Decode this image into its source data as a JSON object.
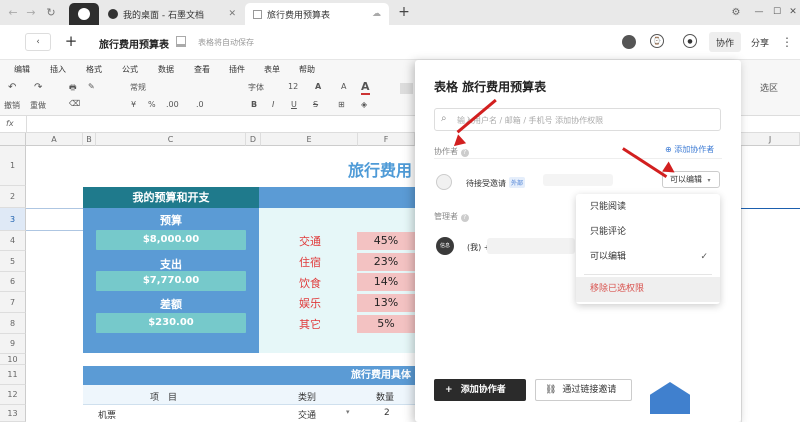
{
  "tabs": [
    {
      "label": "我的桌面 - 石墨文档"
    },
    {
      "label": "旅行费用预算表"
    }
  ],
  "header": {
    "title": "旅行费用预算表",
    "autosave": "表格将自动保存",
    "collab": "协作",
    "share": "分享"
  },
  "menu": [
    "编辑",
    "插入",
    "格式",
    "公式",
    "数据",
    "查看",
    "插件",
    "表单",
    "帮助"
  ],
  "toolbar": {
    "undo": "撤销",
    "redo": "重做",
    "format": "常规",
    "currency": "¥",
    "percent": "%",
    "decimals": ".00",
    ".0": ".0",
    "font": "字体",
    "size": "12",
    "filter_area": "选区"
  },
  "formula": {
    "fx": "fx"
  },
  "columns": [
    "A",
    "B",
    "C",
    "D",
    "E",
    "F",
    "J"
  ],
  "rows": [
    "1",
    "2",
    "3",
    "4",
    "5",
    "6",
    "7",
    "8",
    "9",
    "10",
    "11",
    "12",
    "13"
  ],
  "sheet": {
    "title": "旅行费用",
    "section_title": "我的预算和开支",
    "budget_label": "预算",
    "budget": "$8,000.00",
    "spend_label": "支出",
    "spend": "$7,770.00",
    "diff_label": "差额",
    "diff": "$230.00",
    "categories": [
      "交通",
      "住宿",
      "饮食",
      "娱乐",
      "其它"
    ],
    "pcts": [
      "45%",
      "23%",
      "14%",
      "13%",
      "5%"
    ],
    "detail_title": "旅行费用具体",
    "detail_headers": [
      "项　目",
      "类别",
      "数量"
    ],
    "row13": [
      "机票",
      "交通",
      "2"
    ]
  },
  "panel": {
    "title": "表格 旅行费用预算表",
    "search_placeholder": "输入用户名 / 邮箱 / 手机号 添加协作权限",
    "collaborators": "协作者",
    "add_collab_link": "添加协作者",
    "pending": "待接受邀请",
    "external": "外部",
    "permission": "可以编辑",
    "managers": "管理者",
    "me": "(我) +",
    "avatar_text": "信息",
    "add_button": "添加协作者",
    "invite_button": "通过链接邀请"
  },
  "dropdown": [
    "只能阅读",
    "只能评论",
    "可以编辑",
    "移除已选权限"
  ],
  "colors": {
    "teal": "#1f7a8c",
    "lightteal": "#76c9cb",
    "blue": "#4f9bd7",
    "red": "#d21f1f"
  }
}
